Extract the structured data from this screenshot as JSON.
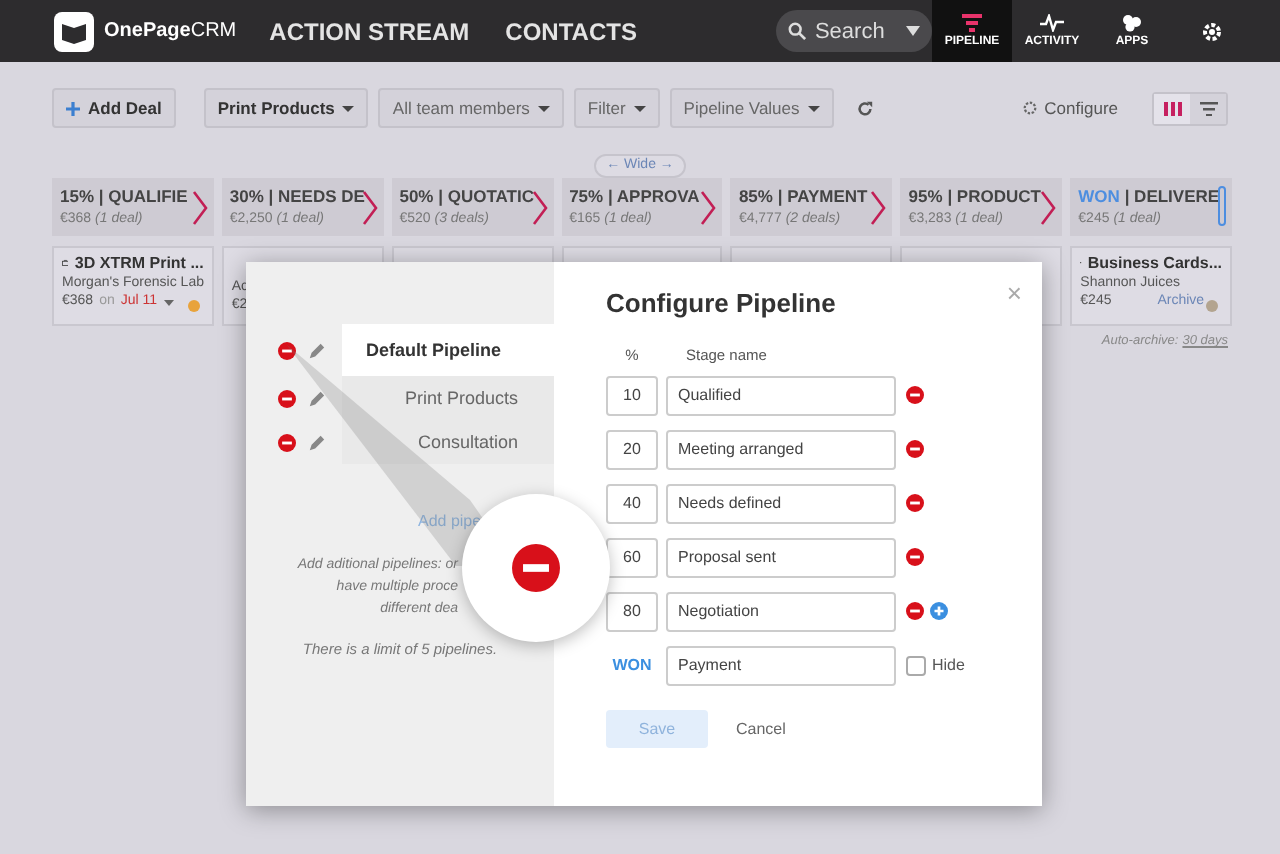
{
  "nav": {
    "logo": "OnePage",
    "logo_suffix": "CRM",
    "links": [
      "ACTION STREAM",
      "CONTACTS"
    ],
    "search": {
      "placeholder": "Search"
    },
    "tabs": [
      {
        "label": "PIPELINE",
        "kind": "pipeline",
        "selected": true
      },
      {
        "label": "ACTIVITY",
        "kind": "activity",
        "selected": false
      },
      {
        "label": "APPS",
        "kind": "apps",
        "selected": false
      }
    ]
  },
  "toolbar": {
    "add_deal": "Add Deal",
    "dropdowns": [
      {
        "label": "Print Products",
        "bold": true
      },
      {
        "label": "All team members",
        "bold": false
      },
      {
        "label": "Filter",
        "bold": false
      },
      {
        "label": "Pipeline Values",
        "bold": false
      }
    ],
    "configure": "Configure",
    "views": [
      {
        "kind": "columns",
        "selected": true
      },
      {
        "kind": "funnel",
        "selected": false
      }
    ]
  },
  "wide": "← Wide →",
  "stages": [
    {
      "kind": "stage",
      "percent": "15%",
      "name": "| QUALIFIE",
      "amount": "€368",
      "count": "(1 deal)"
    },
    {
      "kind": "stage",
      "percent": "30%",
      "name": "| NEEDS DE",
      "amount": "€2,250",
      "count": "(1 deal)"
    },
    {
      "kind": "stage",
      "percent": "50%",
      "name": "| QUOTATIC",
      "amount": "€520",
      "count": "(3 deals)"
    },
    {
      "kind": "stage",
      "percent": "75%",
      "name": "| APPROVA",
      "amount": "€165",
      "count": "(1 deal)"
    },
    {
      "kind": "stage",
      "percent": "85%",
      "name": "| PAYMENT",
      "amount": "€4,777",
      "count": "(2 deals)"
    },
    {
      "kind": "stage",
      "percent": "95%",
      "name": "| PRODUCT",
      "amount": "€3,283",
      "count": "(1 deal)"
    },
    {
      "kind": "won",
      "percent": "WON",
      "name": "| DELIVERE",
      "amount": "€245",
      "count": "(1 deal)"
    }
  ],
  "cards": [
    {
      "kind": "deal",
      "title": "3D XTRM Print ...",
      "company": "Morgan's Forensic Lab",
      "amount": "€368",
      "date_prefix": "on",
      "date": "Jul 11",
      "color": "#e8a33c"
    },
    {
      "kind": "deal",
      "company": "Ac",
      "amount": "€2"
    },
    {
      "kind": "covered"
    },
    {
      "kind": "covered"
    },
    {
      "kind": "covered"
    },
    {
      "kind": "covered"
    },
    {
      "kind": "deal",
      "title": "Business Cards...",
      "company": "Shannon Juices",
      "amount": "€245",
      "action": "Archive",
      "color": "#b3a48f"
    }
  ],
  "auto_archive": {
    "label": "Auto-archive:",
    "link": "30 days"
  },
  "modal": {
    "title": "Configure Pipeline",
    "close": "×",
    "pipelines": [
      {
        "name": "Default Pipeline",
        "selected": true
      },
      {
        "name": "Print Products",
        "selected": false
      },
      {
        "name": "Consultation",
        "selected": false
      }
    ],
    "add_pipeline": "Add pipe",
    "help": [
      "Add aditional pipelines: or",
      "have multiple proce",
      "different dea"
    ],
    "limit": "There is a limit of 5 pipelines.",
    "columns": [
      "%",
      "Stage name"
    ],
    "stages": [
      {
        "kind": "stage",
        "percent": "10",
        "name": "Qualified",
        "addable": false
      },
      {
        "kind": "stage",
        "percent": "20",
        "name": "Meeting arranged",
        "addable": false
      },
      {
        "kind": "stage",
        "percent": "40",
        "name": "Needs defined",
        "addable": false
      },
      {
        "kind": "stage",
        "percent": "60",
        "name": "Proposal sent",
        "addable": false
      },
      {
        "kind": "stage",
        "percent": "80",
        "name": "Negotiation",
        "addable": true
      },
      {
        "kind": "won",
        "percent": "WON",
        "name": "Payment",
        "hide": {
          "label": "Hide",
          "checked": false
        }
      }
    ],
    "save": {
      "label": "Save",
      "disabled": true
    },
    "cancel": "Cancel"
  }
}
